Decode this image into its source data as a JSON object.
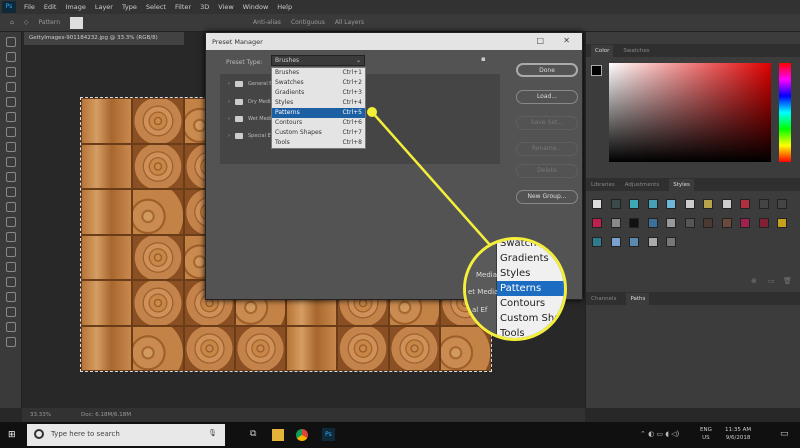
{
  "app": {
    "logo": "Ps",
    "menu": [
      "File",
      "Edit",
      "Image",
      "Layer",
      "Type",
      "Select",
      "Filter",
      "3D",
      "View",
      "Window",
      "Help"
    ]
  },
  "options_bar": {
    "mode_label": "Pattern",
    "antialias": "Anti-alias",
    "contiguous": "Contiguous",
    "all_layers": "All Layers"
  },
  "document": {
    "tab_title": "GettyImages-901184232.jpg @ 33.3% (RGB/8)",
    "zoom": "33.33%",
    "doc_size": "Doc: 6.18M/6.18M"
  },
  "dialog": {
    "title": "Preset Manager",
    "preset_type_label": "Preset Type:",
    "preset_type_value": "Brushes",
    "folders": [
      "General Brushes",
      "Dry Media Brushes",
      "Wet Media Brushes",
      "Special Effects Brushes"
    ],
    "dropdown": [
      {
        "label": "Brushes",
        "shortcut": "Ctrl+1"
      },
      {
        "label": "Swatches",
        "shortcut": "Ctrl+2"
      },
      {
        "label": "Gradients",
        "shortcut": "Ctrl+3"
      },
      {
        "label": "Styles",
        "shortcut": "Ctrl+4"
      },
      {
        "label": "Patterns",
        "shortcut": "Ctrl+5",
        "selected": true
      },
      {
        "label": "Contours",
        "shortcut": "Ctrl+6"
      },
      {
        "label": "Custom Shapes",
        "shortcut": "Ctrl+7"
      },
      {
        "label": "Tools",
        "shortcut": "Ctrl+8"
      }
    ],
    "buttons": {
      "done": "Done",
      "load": "Load...",
      "save_set": "Save Set...",
      "rename": "Rename...",
      "delete": "Delete",
      "new_group": "New Group..."
    }
  },
  "callout": {
    "color": "#f3ef3b",
    "items": [
      "Swatches",
      "Gradients",
      "Styles",
      "Patterns",
      "Contours",
      "Custom Shapes",
      "Tools"
    ],
    "selected": "Patterns",
    "side_labels": [
      "Media",
      "et Media",
      "al Ef"
    ]
  },
  "panels": {
    "color_tabs": [
      "Color",
      "Swatches"
    ],
    "styles_tabs": [
      "Libraries",
      "Adjustments",
      "Styles"
    ],
    "bottom_tabs": [
      "Channels",
      "Paths"
    ]
  },
  "taskbar": {
    "search_placeholder": "Type here to search",
    "lang": "ENG",
    "region": "US",
    "time": "11:35 AM",
    "date": "9/6/2018"
  },
  "colors": {
    "accent": "#1c5fa3",
    "callout": "#f3ef3b"
  }
}
